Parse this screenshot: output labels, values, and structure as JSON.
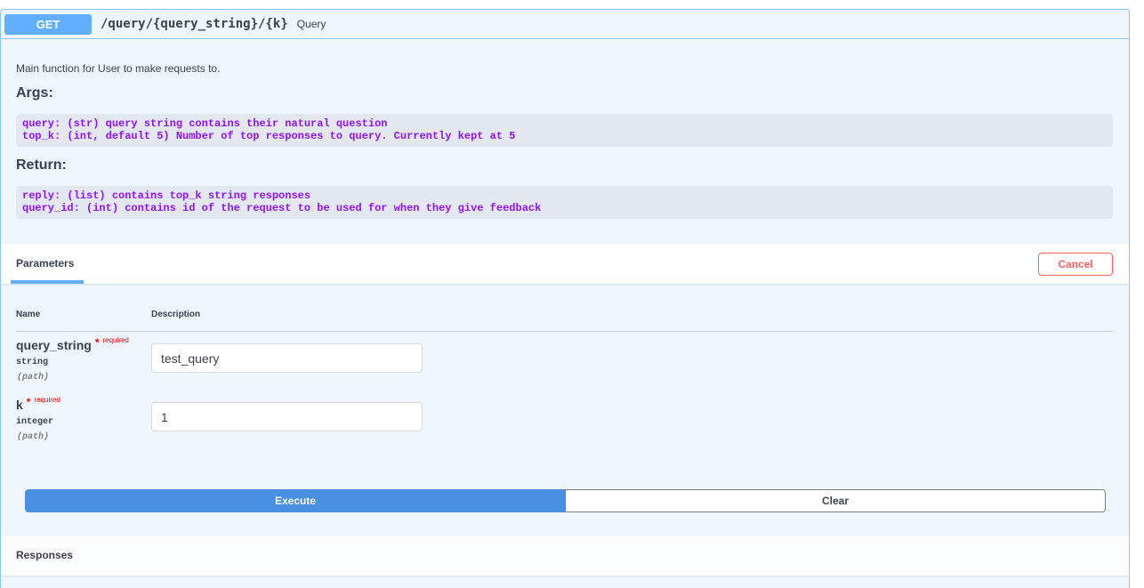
{
  "summary": {
    "method": "GET",
    "path": "/query/{query_string}/{k}",
    "description": "Query"
  },
  "description": {
    "text": "Main function for User to make requests to.",
    "args_heading": "Args:",
    "args_code": [
      "query: (str) query string contains their natural question",
      "top_k: (int, default 5) Number of top responses to query. Currently kept at 5"
    ],
    "return_heading": "Return:",
    "return_code": [
      "reply: (list) contains top_k string responses",
      "query_id: (int) contains id of the request to be used for when they give feedback"
    ]
  },
  "parameters": {
    "tab_label": "Parameters",
    "cancel_label": "Cancel",
    "col_name": "Name",
    "col_description": "Description",
    "items": [
      {
        "name": "query_string",
        "required_star": "*",
        "required_label": "required",
        "type": "string",
        "in": "(path)",
        "value": "test_query"
      },
      {
        "name": "k",
        "required_star": "*",
        "required_label": "required",
        "type": "integer",
        "in": "(path)",
        "value": "1"
      }
    ]
  },
  "actions": {
    "execute_label": "Execute",
    "clear_label": "Clear"
  },
  "responses": {
    "title": "Responses"
  },
  "colors": {
    "get_method": "#61affe",
    "execute": "#4990e2",
    "cancel": "#ff6060",
    "code": "#9012fe",
    "required": "#ff0000"
  }
}
